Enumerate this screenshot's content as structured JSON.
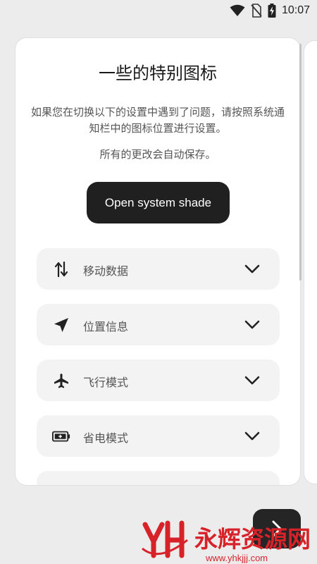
{
  "status": {
    "time": "10:07",
    "icons": [
      "wifi-icon",
      "no-sim-icon",
      "battery-charging-icon"
    ]
  },
  "card": {
    "title": "一些的特别图标",
    "description": "如果您在切换以下的设置中遇到了问题，请按照系统通知栏中的图标位置进行设置。",
    "note": "所有的更改会自动保存。",
    "shade_button": "Open system shade",
    "items": [
      {
        "label": "移动数据",
        "icon": "mobile-data-icon"
      },
      {
        "label": "位置信息",
        "icon": "location-icon"
      },
      {
        "label": "飞行模式",
        "icon": "airplane-icon"
      },
      {
        "label": "省电模式",
        "icon": "battery-saver-icon"
      }
    ]
  },
  "fab": {
    "icon": "next-arrow-icon"
  },
  "watermark": {
    "brand": "永辉资源网",
    "url": "www.yhkjjj.com"
  }
}
